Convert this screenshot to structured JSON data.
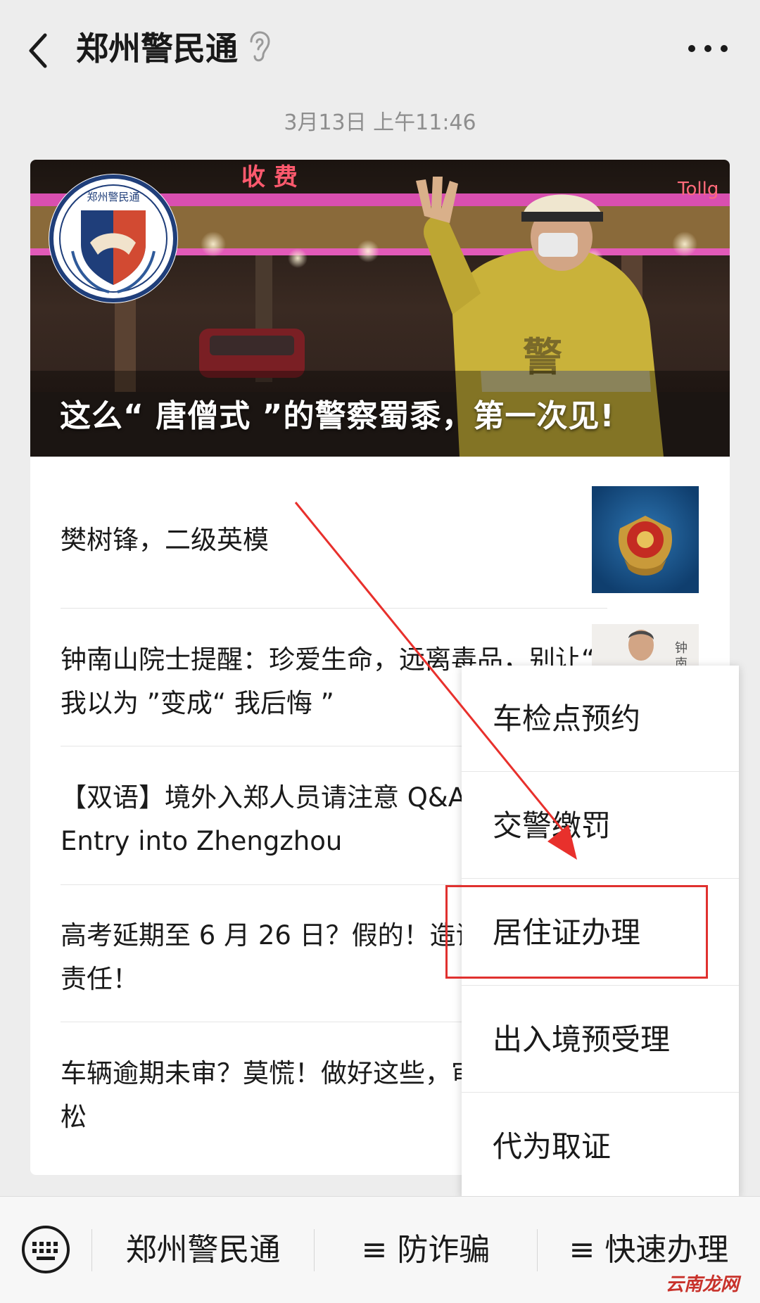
{
  "header": {
    "title": "郑州警民通",
    "back_icon": "chevron-left-icon",
    "ear_icon": "ear-icon",
    "more_icon": "more-dots-icon"
  },
  "timestamp": "3月13日 上午11:46",
  "cover": {
    "title": "这么“ 唐僧式 ”的警察蜀黍，第一次见!",
    "logo_text": "郑州警民通",
    "sign_text": "Tollg"
  },
  "articles": [
    {
      "title": "樊树锋，二级英模"
    },
    {
      "title": "钟南山院士提醒：珍爱生命，远离毒品，别让“ 我以为 ”变成“ 我后悔 ”"
    },
    {
      "title": "【双语】境外入郑人员请注意 Q&A about Entry into Zhengzhou"
    },
    {
      "title": "高考延期至 6 月 26 日？假的！造谣要负法律责任！"
    },
    {
      "title": "车辆逾期未审？莫慌！做好这些，审起来很轻松"
    }
  ],
  "popup_menu": {
    "items": [
      {
        "label": "车检点预约"
      },
      {
        "label": "交警缴罚"
      },
      {
        "label": "居住证办理"
      },
      {
        "label": "出入境预受理"
      },
      {
        "label": "代为取证"
      }
    ],
    "highlighted_index": 2
  },
  "bottom_bar": {
    "keyboard_icon": "keyboard-icon",
    "tabs": [
      {
        "label": "郑州警民通"
      },
      {
        "label": "≡ 防诈骗"
      },
      {
        "label": "≡ 快速办理"
      }
    ]
  },
  "watermark": "云南龙网",
  "colors": {
    "background": "#ededed",
    "highlight_border": "#e0312f",
    "arrow": "#e8302c"
  }
}
